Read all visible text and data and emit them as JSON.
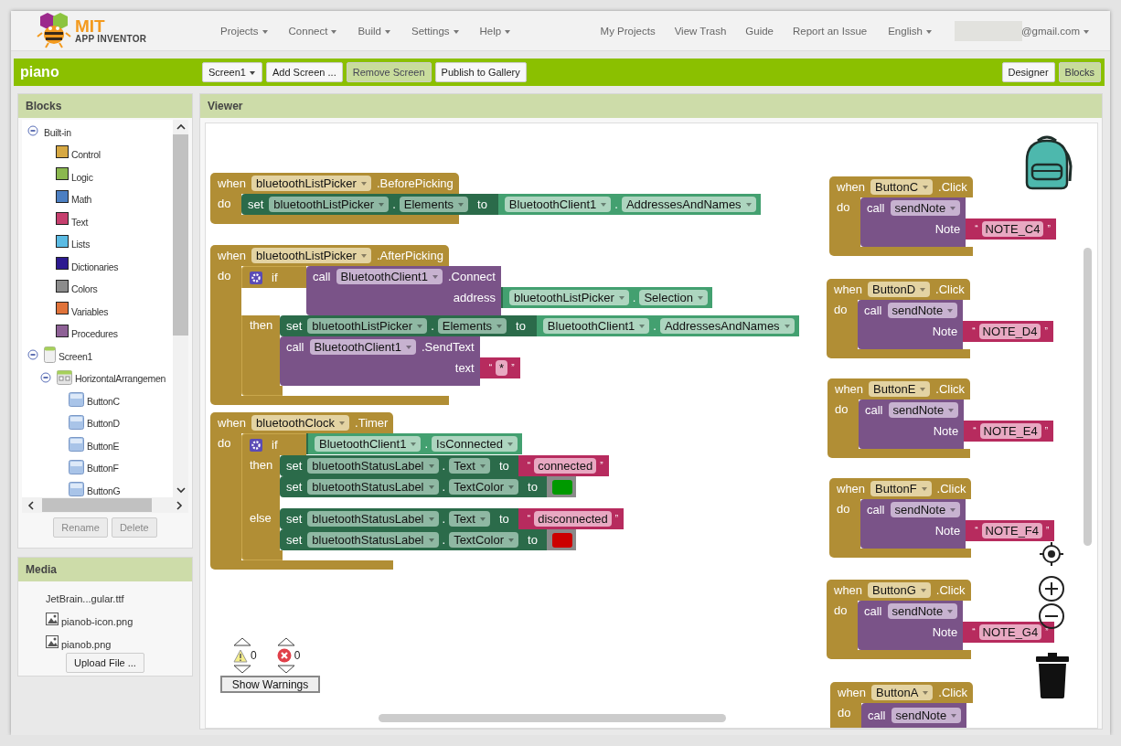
{
  "header": {
    "logo": {
      "title": "MIT",
      "subtitle": "APP INVENTOR"
    },
    "menus": [
      {
        "label": "Projects"
      },
      {
        "label": "Connect"
      },
      {
        "label": "Build"
      },
      {
        "label": "Settings"
      },
      {
        "label": "Help"
      }
    ],
    "links": [
      "My Projects",
      "View Trash",
      "Guide",
      "Report an Issue"
    ],
    "language": "English",
    "account": "@gmail.com"
  },
  "project_bar": {
    "title": "piano",
    "buttons": [
      {
        "label": "Screen1",
        "kind": "dropdown",
        "disabled": false
      },
      {
        "label": "Add Screen ...",
        "kind": "button",
        "disabled": false
      },
      {
        "label": "Remove Screen",
        "kind": "button",
        "disabled": true
      },
      {
        "label": "Publish to Gallery",
        "kind": "button",
        "disabled": false
      }
    ],
    "views": [
      {
        "label": "Designer",
        "selected": false
      },
      {
        "label": "Blocks",
        "selected": true
      }
    ]
  },
  "blocks_panel": {
    "title": "Blocks",
    "tree": [
      {
        "label": "Built-in",
        "expanded": true,
        "children": [
          {
            "label": "Control",
            "color": "#d6a843"
          },
          {
            "label": "Logic",
            "color": "#8bb84f"
          },
          {
            "label": "Math",
            "color": "#4c7fc2"
          },
          {
            "label": "Text",
            "color": "#c63f6e"
          },
          {
            "label": "Lists",
            "color": "#5bbbe3"
          },
          {
            "label": "Dictionaries",
            "color": "#2c1a90"
          },
          {
            "label": "Colors",
            "color": "#8c8c8c"
          },
          {
            "label": "Variables",
            "color": "#e0733a"
          },
          {
            "label": "Procedures",
            "color": "#8e6196"
          }
        ]
      },
      {
        "label": "Screen1",
        "kind": "screen",
        "expanded": true,
        "children": [
          {
            "label": "HorizontalArrangemen",
            "kind": "arrangement",
            "expanded": true,
            "children": [
              {
                "label": "ButtonC",
                "kind": "button"
              },
              {
                "label": "ButtonD",
                "kind": "button"
              },
              {
                "label": "ButtonE",
                "kind": "button"
              },
              {
                "label": "ButtonF",
                "kind": "button"
              },
              {
                "label": "ButtonG",
                "kind": "button"
              }
            ]
          }
        ]
      }
    ],
    "buttons": [
      {
        "label": "Rename",
        "disabled": true
      },
      {
        "label": "Delete",
        "disabled": true
      }
    ]
  },
  "media_panel": {
    "title": "Media",
    "files": [
      {
        "name": "JetBrain...gular.ttf",
        "kind": "font"
      },
      {
        "name": "pianob-icon.png",
        "kind": "image"
      },
      {
        "name": "pianob.png",
        "kind": "image"
      }
    ],
    "upload": "Upload File ..."
  },
  "viewer": {
    "title": "Viewer",
    "blocks": [
      {
        "when": "when",
        "component": "bluetoothListPicker",
        "event": ".BeforePicking",
        "do": "do",
        "body": [
          {
            "kind": "set",
            "keyword": "set",
            "component": "bluetoothListPicker",
            "dot": ".",
            "property": "Elements",
            "to": "to",
            "value": {
              "kind": "getter",
              "component": "BluetoothClient1",
              "dot": ".",
              "property": "AddressesAndNames"
            }
          }
        ]
      },
      {
        "when": "when",
        "component": "bluetoothListPicker",
        "event": ".AfterPicking",
        "do": "do",
        "body": [
          {
            "kind": "if",
            "keyword": "if",
            "condition": {
              "kind": "call",
              "keyword": "call",
              "component": "BluetoothClient1",
              "method": ".Connect",
              "args": [
                {
                  "name": "address",
                  "value": {
                    "kind": "getter",
                    "component": "bluetoothListPicker",
                    "dot": ".",
                    "property": "Selection"
                  }
                }
              ]
            },
            "then": "then",
            "body": [
              {
                "kind": "set",
                "keyword": "set",
                "component": "bluetoothListPicker",
                "dot": ".",
                "property": "Elements",
                "to": "to",
                "value": {
                  "kind": "getter",
                  "component": "BluetoothClient1",
                  "dot": ".",
                  "property": "AddressesAndNames"
                }
              },
              {
                "kind": "call",
                "keyword": "call",
                "component": "BluetoothClient1",
                "method": ".SendText",
                "args": [
                  {
                    "name": "text",
                    "value": {
                      "kind": "text",
                      "open": "“",
                      "value": "*",
                      "close": "”"
                    }
                  }
                ]
              }
            ]
          }
        ]
      },
      {
        "when": "when",
        "component": "bluetoothClock",
        "event": ".Timer",
        "do": "do",
        "body": [
          {
            "kind": "if",
            "keyword": "if",
            "condition": {
              "kind": "getter",
              "component": "BluetoothClient1",
              "dot": ".",
              "property": "IsConnected"
            },
            "then": "then",
            "body": [
              {
                "kind": "set",
                "keyword": "set",
                "component": "bluetoothStatusLabel",
                "dot": ".",
                "property": "Text",
                "to": "to",
                "value": {
                  "kind": "text",
                  "open": "“",
                  "value": "connected",
                  "close": "”"
                }
              },
              {
                "kind": "set",
                "keyword": "set",
                "component": "bluetoothStatusLabel",
                "dot": ".",
                "property": "TextColor",
                "to": "to",
                "value": {
                  "kind": "color",
                  "color": "#009900"
                }
              }
            ],
            "else": "else",
            "else_body": [
              {
                "kind": "set",
                "keyword": "set",
                "component": "bluetoothStatusLabel",
                "dot": ".",
                "property": "Text",
                "to": "to",
                "value": {
                  "kind": "text",
                  "open": "“",
                  "value": "disconnected",
                  "close": "”"
                }
              },
              {
                "kind": "set",
                "keyword": "set",
                "component": "bluetoothStatusLabel",
                "dot": ".",
                "property": "TextColor",
                "to": "to",
                "value": {
                  "kind": "color",
                  "color": "#cc0000"
                }
              }
            ]
          }
        ]
      },
      {
        "when": "when",
        "component": "ButtonC",
        "event": ".Click",
        "do": "do",
        "body": [
          {
            "kind": "call",
            "keyword": "call",
            "procedure": "sendNote",
            "args": [
              {
                "name": "Note",
                "value": {
                  "kind": "text",
                  "open": "“",
                  "value": "NOTE_C4",
                  "close": "”"
                }
              }
            ]
          }
        ]
      },
      {
        "when": "when",
        "component": "ButtonD",
        "event": ".Click",
        "do": "do",
        "body": [
          {
            "kind": "call",
            "keyword": "call",
            "procedure": "sendNote",
            "args": [
              {
                "name": "Note",
                "value": {
                  "kind": "text",
                  "open": "“",
                  "value": "NOTE_D4",
                  "close": "”"
                }
              }
            ]
          }
        ]
      },
      {
        "when": "when",
        "component": "ButtonE",
        "event": ".Click",
        "do": "do",
        "body": [
          {
            "kind": "call",
            "keyword": "call",
            "procedure": "sendNote",
            "args": [
              {
                "name": "Note",
                "value": {
                  "kind": "text",
                  "open": "“",
                  "value": "NOTE_E4",
                  "close": "”"
                }
              }
            ]
          }
        ]
      },
      {
        "when": "when",
        "component": "ButtonF",
        "event": ".Click",
        "do": "do",
        "body": [
          {
            "kind": "call",
            "keyword": "call",
            "procedure": "sendNote",
            "args": [
              {
                "name": "Note",
                "value": {
                  "kind": "text",
                  "open": "“",
                  "value": "NOTE_F4",
                  "close": "”"
                }
              }
            ]
          }
        ]
      },
      {
        "when": "when",
        "component": "ButtonG",
        "event": ".Click",
        "do": "do",
        "body": [
          {
            "kind": "call",
            "keyword": "call",
            "procedure": "sendNote",
            "args": [
              {
                "name": "Note",
                "value": {
                  "kind": "text",
                  "open": "“",
                  "value": "NOTE_G4",
                  "close": "”"
                }
              }
            ]
          }
        ]
      },
      {
        "when": "when",
        "component": "ButtonA",
        "event": ".Click",
        "do": "do",
        "body": [
          {
            "kind": "call",
            "keyword": "call",
            "procedure": "sendNote"
          }
        ]
      }
    ],
    "warnings": {
      "count": "0"
    },
    "errors": {
      "count": "0"
    },
    "show_warnings": "Show Warnings"
  }
}
